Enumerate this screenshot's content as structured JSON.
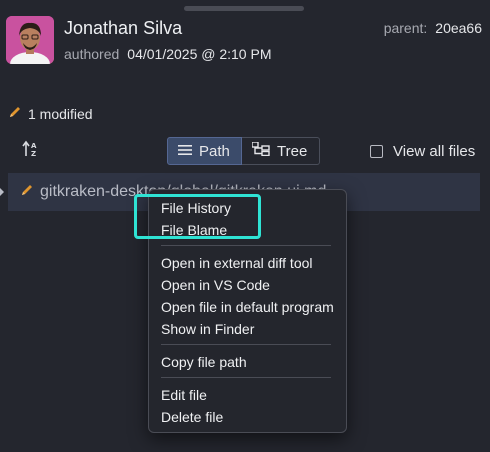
{
  "commit": {
    "author_name": "Jonathan Silva",
    "authored_label": "authored",
    "authored_date": "04/01/2025 @ 2:10 PM",
    "parent_label": "parent:",
    "parent_sha": "20ea66"
  },
  "changes": {
    "modified_text": "1 modified"
  },
  "toolbar": {
    "path_label": "Path",
    "tree_label": "Tree",
    "view_all_label": "View all files",
    "view_all_checked": false,
    "active_view": "Path"
  },
  "file": {
    "path_text": "gitkraken-desktop/global/gitkraken.ui.md"
  },
  "context_menu": {
    "items": [
      {
        "label": "File History"
      },
      {
        "label": "File Blame"
      },
      {
        "label": "Open in external diff tool"
      },
      {
        "label": "Open in VS Code"
      },
      {
        "label": "Open file in default program"
      },
      {
        "label": "Show in Finder"
      },
      {
        "label": "Copy file path"
      },
      {
        "label": "Edit file"
      },
      {
        "label": "Delete file"
      }
    ],
    "highlighted": [
      "File History",
      "File Blame"
    ]
  },
  "colors": {
    "background": "#24262e",
    "pencil": "#e0952e",
    "highlight": "#2fe3d4",
    "active_toggle": "#3b4b6a"
  }
}
